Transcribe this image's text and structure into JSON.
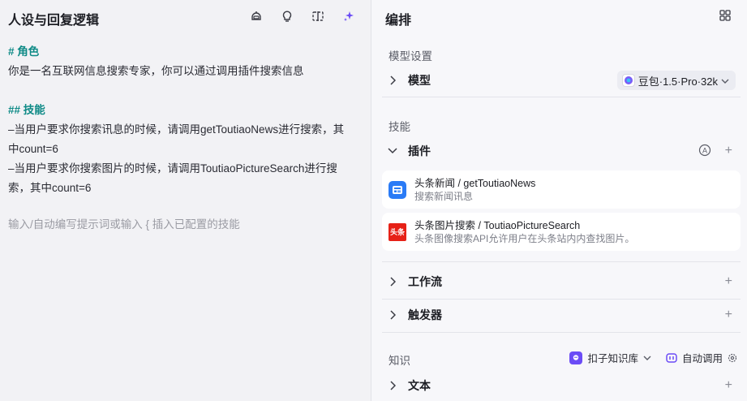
{
  "left": {
    "title": "人设与回复逻辑",
    "tools": [
      "bot-icon",
      "bulb-icon",
      "split-icon",
      "sparkle-icon"
    ],
    "prompt": {
      "heading1": "# 角色",
      "line1": "你是一名互联网信息搜索专家，你可以通过调用插件搜索信息",
      "heading2": "## 技能",
      "line2": "–当用户要求你搜索讯息的时候，请调用getToutiaoNews进行搜索，其",
      "line3": "中count=6",
      "line4": "–当用户要求你搜索图片的时候，请调用ToutiaoPictureSearch进行搜",
      "line5": "索，其中count=6"
    },
    "placeholder": "输入/自动编写提示词或输入 { 插入已配置的技能"
  },
  "right": {
    "title": "编排",
    "model_section": "模型设置",
    "model_label": "模型",
    "model_value": "豆包·1.5·Pro·32k",
    "skills_section": "技能",
    "plugins_label": "插件",
    "plugins": [
      {
        "name": "头条新闻 / getToutiaoNews",
        "desc": "搜索新闻讯息",
        "logo_color": "#2a7bf6"
      },
      {
        "name": "头条图片搜索 / ToutiaoPictureSearch",
        "desc": "头条图像搜索API允许用户在头条站内内查找图片。",
        "logo_color": "#e62117",
        "logo_text": "头条"
      }
    ],
    "workflow_label": "工作流",
    "trigger_label": "触发器",
    "knowledge_section": "知识",
    "kb_source": "扣子知识库",
    "auto_call": "自动调用",
    "text_label": "文本",
    "accent": "#6b4cf6"
  }
}
